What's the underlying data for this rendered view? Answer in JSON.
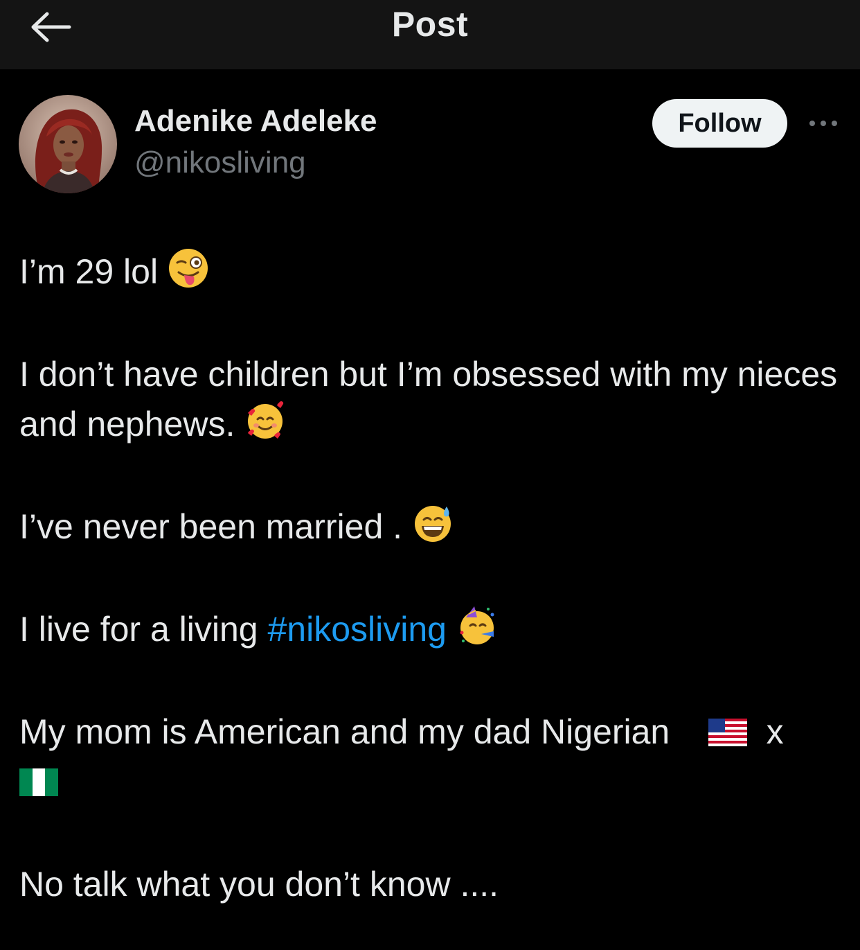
{
  "header": {
    "title": "Post",
    "back_icon": "arrow-left-icon"
  },
  "author": {
    "display_name": "Adenike Adeleke",
    "handle": "@nikosliving",
    "avatar_icon": "avatar"
  },
  "actions": {
    "follow_label": "Follow",
    "more_icon": "more-horizontal-icon"
  },
  "post": {
    "p1": "I’m 29 lol",
    "p2": "I don’t have  children but I’m obsessed with my nieces and nephews.",
    "p3": "I’ve never been married .",
    "p4_prefix": "I live for a living",
    "p4_hashtag": "#nikosliving",
    "p5_prefix": "My mom is American and my dad Nigerian",
    "p5_x": "x",
    "p6": "No talk what you don’t know ...."
  },
  "colors": {
    "background": "#000000",
    "header_bg": "#141414",
    "text": "#e7e9ea",
    "secondary_text": "#71767b",
    "link": "#1d9bf0",
    "follow_bg": "#eff3f4"
  }
}
